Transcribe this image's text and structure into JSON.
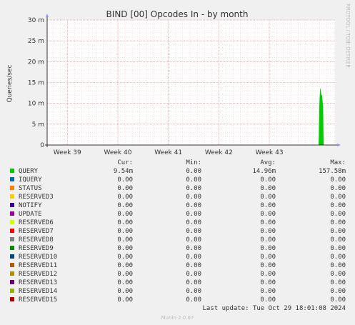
{
  "colors": {
    "background": "#f0f0f0",
    "plot_bg": "#ffffff",
    "grid_major": "#e09090",
    "grid_minor": "#e8c0c0",
    "axis": "#000000",
    "series_main": "#00cc00"
  },
  "sidebar_text": "RRDTOOL / TOBI OETIKER",
  "legend": {
    "headers": {
      "cur": "Cur:",
      "min": "Min:",
      "avg": "Avg:",
      "max": "Max:"
    },
    "rows": [
      {
        "name": "QUERY",
        "color": "#00cc00",
        "cur": "9.54m",
        "min": "0.00",
        "avg": "14.96m",
        "max": "157.58m"
      },
      {
        "name": "IQUERY",
        "color": "#0066b3",
        "cur": "0.00",
        "min": "0.00",
        "avg": "0.00",
        "max": "0.00"
      },
      {
        "name": "STATUS",
        "color": "#ff8000",
        "cur": "0.00",
        "min": "0.00",
        "avg": "0.00",
        "max": "0.00"
      },
      {
        "name": "RESERVED3",
        "color": "#ffcc00",
        "cur": "0.00",
        "min": "0.00",
        "avg": "0.00",
        "max": "0.00"
      },
      {
        "name": "NOTIFY",
        "color": "#330099",
        "cur": "0.00",
        "min": "0.00",
        "avg": "0.00",
        "max": "0.00"
      },
      {
        "name": "UPDATE",
        "color": "#990099",
        "cur": "0.00",
        "min": "0.00",
        "avg": "0.00",
        "max": "0.00"
      },
      {
        "name": "RESERVED6",
        "color": "#ccff00",
        "cur": "0.00",
        "min": "0.00",
        "avg": "0.00",
        "max": "0.00"
      },
      {
        "name": "RESERVED7",
        "color": "#ff0000",
        "cur": "0.00",
        "min": "0.00",
        "avg": "0.00",
        "max": "0.00"
      },
      {
        "name": "RESERVED8",
        "color": "#808080",
        "cur": "0.00",
        "min": "0.00",
        "avg": "0.00",
        "max": "0.00"
      },
      {
        "name": "RESERVED9",
        "color": "#008f00",
        "cur": "0.00",
        "min": "0.00",
        "avg": "0.00",
        "max": "0.00"
      },
      {
        "name": "RESERVED10",
        "color": "#00487d",
        "cur": "0.00",
        "min": "0.00",
        "avg": "0.00",
        "max": "0.00"
      },
      {
        "name": "RESERVED11",
        "color": "#b35a00",
        "cur": "0.00",
        "min": "0.00",
        "avg": "0.00",
        "max": "0.00"
      },
      {
        "name": "RESERVED12",
        "color": "#b38f00",
        "cur": "0.00",
        "min": "0.00",
        "avg": "0.00",
        "max": "0.00"
      },
      {
        "name": "RESERVED13",
        "color": "#6b006b",
        "cur": "0.00",
        "min": "0.00",
        "avg": "0.00",
        "max": "0.00"
      },
      {
        "name": "RESERVED14",
        "color": "#8fb300",
        "cur": "0.00",
        "min": "0.00",
        "avg": "0.00",
        "max": "0.00"
      },
      {
        "name": "RESERVED15",
        "color": "#b30000",
        "cur": "0.00",
        "min": "0.00",
        "avg": "0.00",
        "max": "0.00"
      }
    ]
  },
  "last_update": "Last update: Tue Oct 29 18:01:08 2024",
  "footer": "Munin 2.0.67",
  "chart_data": {
    "type": "area",
    "title": "BIND [00] Opcodes In - by month",
    "ylabel": "Queries/sec",
    "xlabel": "",
    "ylim": [
      0,
      0.03
    ],
    "xlim": [
      38.6,
      44.3
    ],
    "grid": true,
    "y_ticks": [
      {
        "value": 0,
        "label": "0"
      },
      {
        "value": 0.005,
        "label": "5 m"
      },
      {
        "value": 0.01,
        "label": "10 m"
      },
      {
        "value": 0.015,
        "label": "15 m"
      },
      {
        "value": 0.02,
        "label": "20 m"
      },
      {
        "value": 0.025,
        "label": "25 m"
      },
      {
        "value": 0.03,
        "label": "30 m"
      }
    ],
    "x_ticks": [
      {
        "value": 39,
        "label": "Week 39"
      },
      {
        "value": 40,
        "label": "Week 40"
      },
      {
        "value": 41,
        "label": "Week 41"
      },
      {
        "value": 42,
        "label": "Week 42"
      },
      {
        "value": 43,
        "label": "Week 43"
      }
    ],
    "series": [
      {
        "name": "QUERY",
        "x": [
          43.98,
          43.995,
          44.01,
          44.02,
          44.03,
          44.04,
          44.05,
          44.06,
          44.07
        ],
        "values": [
          0.0,
          0.01,
          0.0135,
          0.0125,
          0.0115,
          0.012,
          0.0105,
          0.0095,
          0.0
        ]
      }
    ]
  }
}
